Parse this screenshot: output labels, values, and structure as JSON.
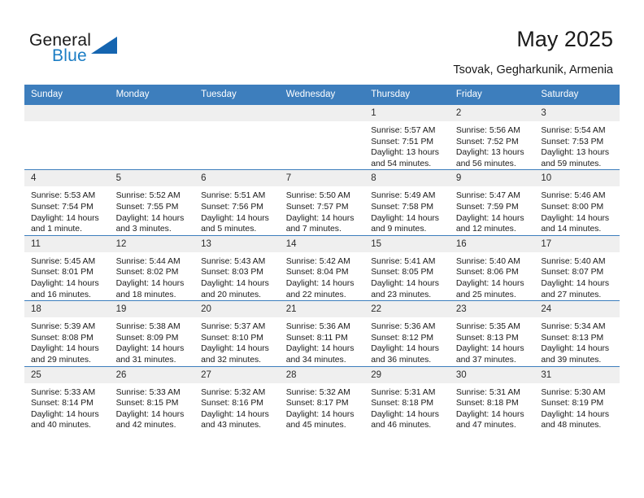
{
  "brand": {
    "name_part1": "General",
    "name_part2": "Blue",
    "accent_color": "#1b7dc4",
    "triangle_color": "#1565b0"
  },
  "header": {
    "title": "May 2025",
    "subtitle": "Tsovak, Gegharkunik, Armenia",
    "header_background": "#3d7ebd"
  },
  "weekdays": [
    "Sunday",
    "Monday",
    "Tuesday",
    "Wednesday",
    "Thursday",
    "Friday",
    "Saturday"
  ],
  "weeks": [
    [
      {
        "day": "",
        "empty": true
      },
      {
        "day": "",
        "empty": true
      },
      {
        "day": "",
        "empty": true
      },
      {
        "day": "",
        "empty": true
      },
      {
        "day": "1",
        "sunrise": "Sunrise: 5:57 AM",
        "sunset": "Sunset: 7:51 PM",
        "daylight": "Daylight: 13 hours and 54 minutes."
      },
      {
        "day": "2",
        "sunrise": "Sunrise: 5:56 AM",
        "sunset": "Sunset: 7:52 PM",
        "daylight": "Daylight: 13 hours and 56 minutes."
      },
      {
        "day": "3",
        "sunrise": "Sunrise: 5:54 AM",
        "sunset": "Sunset: 7:53 PM",
        "daylight": "Daylight: 13 hours and 59 minutes."
      }
    ],
    [
      {
        "day": "4",
        "sunrise": "Sunrise: 5:53 AM",
        "sunset": "Sunset: 7:54 PM",
        "daylight": "Daylight: 14 hours and 1 minute."
      },
      {
        "day": "5",
        "sunrise": "Sunrise: 5:52 AM",
        "sunset": "Sunset: 7:55 PM",
        "daylight": "Daylight: 14 hours and 3 minutes."
      },
      {
        "day": "6",
        "sunrise": "Sunrise: 5:51 AM",
        "sunset": "Sunset: 7:56 PM",
        "daylight": "Daylight: 14 hours and 5 minutes."
      },
      {
        "day": "7",
        "sunrise": "Sunrise: 5:50 AM",
        "sunset": "Sunset: 7:57 PM",
        "daylight": "Daylight: 14 hours and 7 minutes."
      },
      {
        "day": "8",
        "sunrise": "Sunrise: 5:49 AM",
        "sunset": "Sunset: 7:58 PM",
        "daylight": "Daylight: 14 hours and 9 minutes."
      },
      {
        "day": "9",
        "sunrise": "Sunrise: 5:47 AM",
        "sunset": "Sunset: 7:59 PM",
        "daylight": "Daylight: 14 hours and 12 minutes."
      },
      {
        "day": "10",
        "sunrise": "Sunrise: 5:46 AM",
        "sunset": "Sunset: 8:00 PM",
        "daylight": "Daylight: 14 hours and 14 minutes."
      }
    ],
    [
      {
        "day": "11",
        "sunrise": "Sunrise: 5:45 AM",
        "sunset": "Sunset: 8:01 PM",
        "daylight": "Daylight: 14 hours and 16 minutes."
      },
      {
        "day": "12",
        "sunrise": "Sunrise: 5:44 AM",
        "sunset": "Sunset: 8:02 PM",
        "daylight": "Daylight: 14 hours and 18 minutes."
      },
      {
        "day": "13",
        "sunrise": "Sunrise: 5:43 AM",
        "sunset": "Sunset: 8:03 PM",
        "daylight": "Daylight: 14 hours and 20 minutes."
      },
      {
        "day": "14",
        "sunrise": "Sunrise: 5:42 AM",
        "sunset": "Sunset: 8:04 PM",
        "daylight": "Daylight: 14 hours and 22 minutes."
      },
      {
        "day": "15",
        "sunrise": "Sunrise: 5:41 AM",
        "sunset": "Sunset: 8:05 PM",
        "daylight": "Daylight: 14 hours and 23 minutes."
      },
      {
        "day": "16",
        "sunrise": "Sunrise: 5:40 AM",
        "sunset": "Sunset: 8:06 PM",
        "daylight": "Daylight: 14 hours and 25 minutes."
      },
      {
        "day": "17",
        "sunrise": "Sunrise: 5:40 AM",
        "sunset": "Sunset: 8:07 PM",
        "daylight": "Daylight: 14 hours and 27 minutes."
      }
    ],
    [
      {
        "day": "18",
        "sunrise": "Sunrise: 5:39 AM",
        "sunset": "Sunset: 8:08 PM",
        "daylight": "Daylight: 14 hours and 29 minutes."
      },
      {
        "day": "19",
        "sunrise": "Sunrise: 5:38 AM",
        "sunset": "Sunset: 8:09 PM",
        "daylight": "Daylight: 14 hours and 31 minutes."
      },
      {
        "day": "20",
        "sunrise": "Sunrise: 5:37 AM",
        "sunset": "Sunset: 8:10 PM",
        "daylight": "Daylight: 14 hours and 32 minutes."
      },
      {
        "day": "21",
        "sunrise": "Sunrise: 5:36 AM",
        "sunset": "Sunset: 8:11 PM",
        "daylight": "Daylight: 14 hours and 34 minutes."
      },
      {
        "day": "22",
        "sunrise": "Sunrise: 5:36 AM",
        "sunset": "Sunset: 8:12 PM",
        "daylight": "Daylight: 14 hours and 36 minutes."
      },
      {
        "day": "23",
        "sunrise": "Sunrise: 5:35 AM",
        "sunset": "Sunset: 8:13 PM",
        "daylight": "Daylight: 14 hours and 37 minutes."
      },
      {
        "day": "24",
        "sunrise": "Sunrise: 5:34 AM",
        "sunset": "Sunset: 8:13 PM",
        "daylight": "Daylight: 14 hours and 39 minutes."
      }
    ],
    [
      {
        "day": "25",
        "sunrise": "Sunrise: 5:33 AM",
        "sunset": "Sunset: 8:14 PM",
        "daylight": "Daylight: 14 hours and 40 minutes."
      },
      {
        "day": "26",
        "sunrise": "Sunrise: 5:33 AM",
        "sunset": "Sunset: 8:15 PM",
        "daylight": "Daylight: 14 hours and 42 minutes."
      },
      {
        "day": "27",
        "sunrise": "Sunrise: 5:32 AM",
        "sunset": "Sunset: 8:16 PM",
        "daylight": "Daylight: 14 hours and 43 minutes."
      },
      {
        "day": "28",
        "sunrise": "Sunrise: 5:32 AM",
        "sunset": "Sunset: 8:17 PM",
        "daylight": "Daylight: 14 hours and 45 minutes."
      },
      {
        "day": "29",
        "sunrise": "Sunrise: 5:31 AM",
        "sunset": "Sunset: 8:18 PM",
        "daylight": "Daylight: 14 hours and 46 minutes."
      },
      {
        "day": "30",
        "sunrise": "Sunrise: 5:31 AM",
        "sunset": "Sunset: 8:18 PM",
        "daylight": "Daylight: 14 hours and 47 minutes."
      },
      {
        "day": "31",
        "sunrise": "Sunrise: 5:30 AM",
        "sunset": "Sunset: 8:19 PM",
        "daylight": "Daylight: 14 hours and 48 minutes."
      }
    ]
  ]
}
